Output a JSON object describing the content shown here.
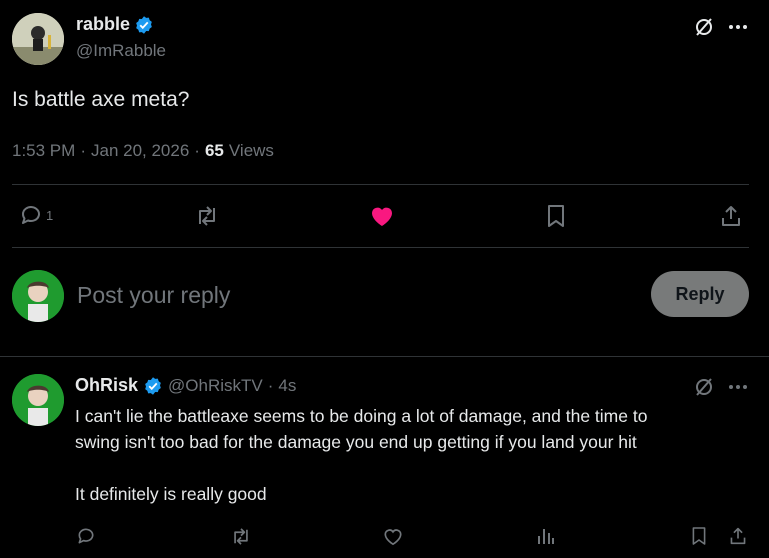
{
  "post": {
    "display_name": "rabble",
    "handle": "@ImRabble",
    "text": "Is battle axe meta?",
    "time": "1:53 PM",
    "date": "Jan 20, 2026",
    "views_count": "65",
    "views_label": "Views",
    "reply_count": "1"
  },
  "composer": {
    "placeholder": "Post your reply",
    "reply_button": "Reply"
  },
  "reply": {
    "display_name": "OhRisk",
    "handle": "@OhRiskTV",
    "age": "4s",
    "text_line1": "I can't lie the battleaxe seems to be doing a lot of damage, and the time to",
    "text_line2": "swing isn't too bad for the damage you end up getting if you land your hit",
    "text_line3": "It definitely is really good"
  },
  "colors": {
    "verified": "#1d9bf0",
    "like": "#f91880",
    "muted": "#71767b"
  }
}
